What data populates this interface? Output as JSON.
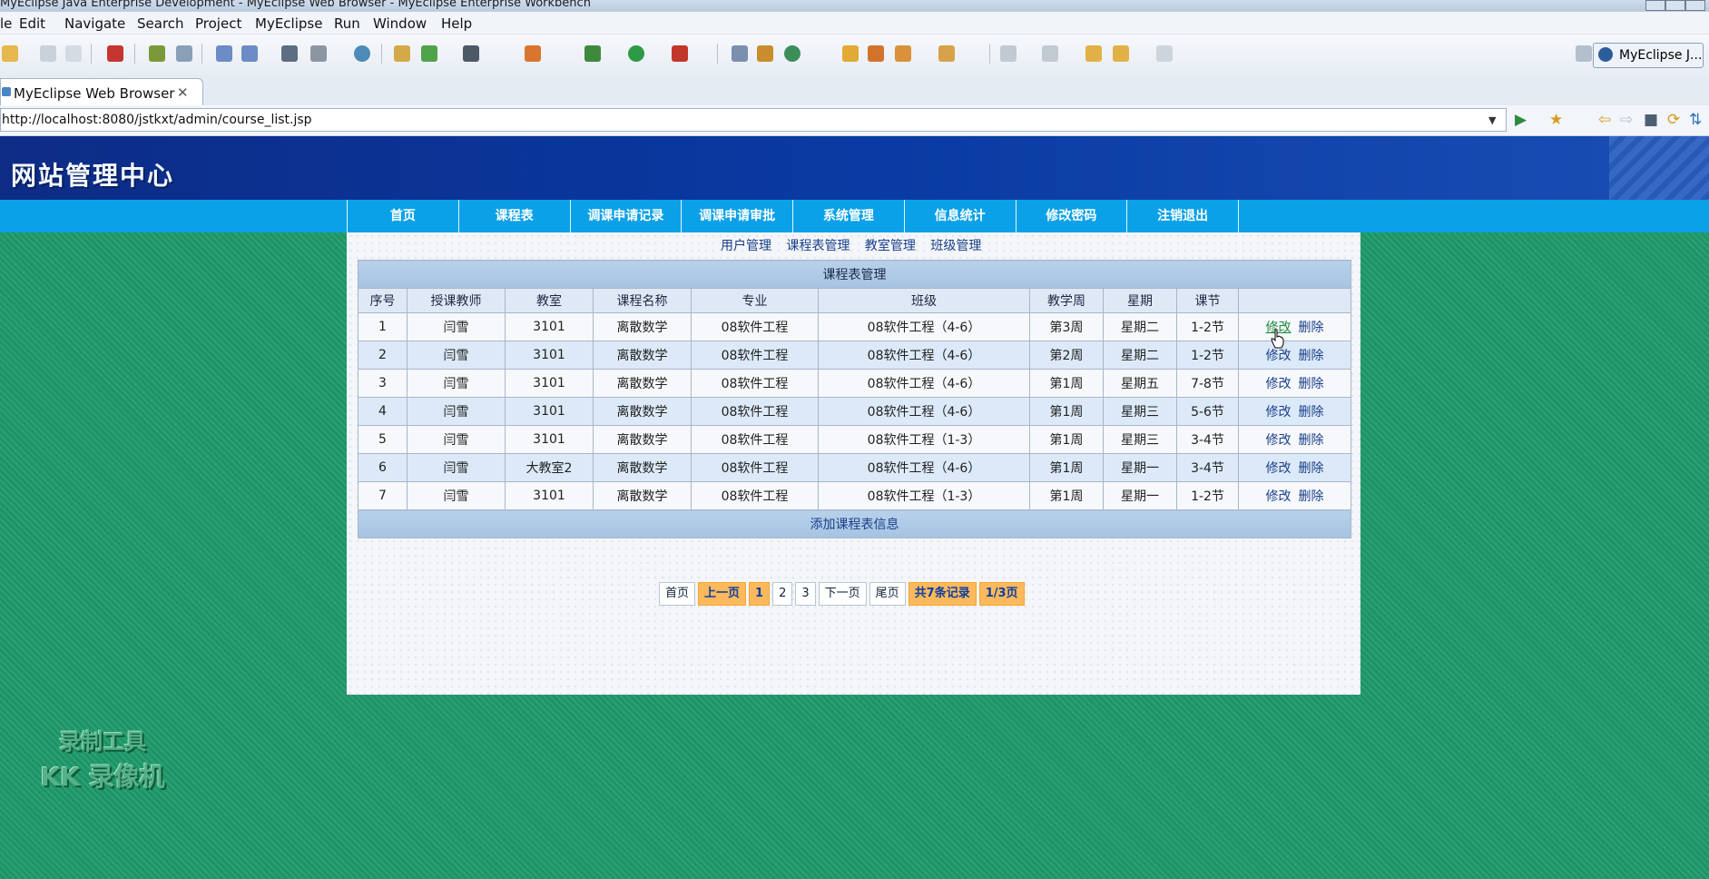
{
  "window": {
    "title": "MyEclipse Java Enterprise Development - MyEclipse Web Browser - MyEclipse Enterprise Workbench"
  },
  "menu": [
    "le",
    "Edit",
    "Navigate",
    "Search",
    "Project",
    "MyEclipse",
    "Run",
    "Window",
    "Help"
  ],
  "perspective": {
    "label": "MyEclipse J..."
  },
  "editor_tab": {
    "label": "MyEclipse Web Browser",
    "close": "✕"
  },
  "url": {
    "value": "http://localhost:8080/jstkxt/admin/course_list.jsp"
  },
  "site": {
    "title": "网站管理中心"
  },
  "nav": [
    "首页",
    "课程表",
    "调课申请记录",
    "调课申请审批",
    "系统管理",
    "信息统计",
    "修改密码",
    "注销退出"
  ],
  "subnav": [
    "用户管理",
    "课程表管理",
    "教室管理",
    "班级管理"
  ],
  "table": {
    "caption": "课程表管理",
    "headers": [
      "序号",
      "授课教师",
      "教室",
      "课程名称",
      "专业",
      "班级",
      "教学周",
      "星期",
      "课节",
      ""
    ],
    "rows": [
      {
        "no": "1",
        "teacher": "闫雪",
        "room": "3101",
        "course": "离散数学",
        "major": "08软件工程",
        "class": "08软件工程（4-6）",
        "week": "第3周",
        "day": "星期二",
        "period": "1-2节"
      },
      {
        "no": "2",
        "teacher": "闫雪",
        "room": "3101",
        "course": "离散数学",
        "major": "08软件工程",
        "class": "08软件工程（4-6）",
        "week": "第2周",
        "day": "星期二",
        "period": "1-2节"
      },
      {
        "no": "3",
        "teacher": "闫雪",
        "room": "3101",
        "course": "离散数学",
        "major": "08软件工程",
        "class": "08软件工程（4-6）",
        "week": "第1周",
        "day": "星期五",
        "period": "7-8节"
      },
      {
        "no": "4",
        "teacher": "闫雪",
        "room": "3101",
        "course": "离散数学",
        "major": "08软件工程",
        "class": "08软件工程（4-6）",
        "week": "第1周",
        "day": "星期三",
        "period": "5-6节"
      },
      {
        "no": "5",
        "teacher": "闫雪",
        "room": "3101",
        "course": "离散数学",
        "major": "08软件工程",
        "class": "08软件工程（1-3）",
        "week": "第1周",
        "day": "星期三",
        "period": "3-4节"
      },
      {
        "no": "6",
        "teacher": "闫雪",
        "room": "大教室2",
        "course": "离散数学",
        "major": "08软件工程",
        "class": "08软件工程（4-6）",
        "week": "第1周",
        "day": "星期一",
        "period": "3-4节"
      },
      {
        "no": "7",
        "teacher": "闫雪",
        "room": "3101",
        "course": "离散数学",
        "major": "08软件工程",
        "class": "08软件工程（1-3）",
        "week": "第1周",
        "day": "星期一",
        "period": "1-2节"
      }
    ],
    "edit_label": "修改",
    "delete_label": "删除",
    "add_label": "添加课程表信息"
  },
  "pager": {
    "first": "首页",
    "prev": "上一页",
    "pages": [
      "1",
      "2",
      "3"
    ],
    "next": "下一页",
    "last": "尾页",
    "total": "共7条记录",
    "page_of": "1/3页"
  },
  "watermark": {
    "line1": "录制工具",
    "line2": "KK 录像机"
  }
}
